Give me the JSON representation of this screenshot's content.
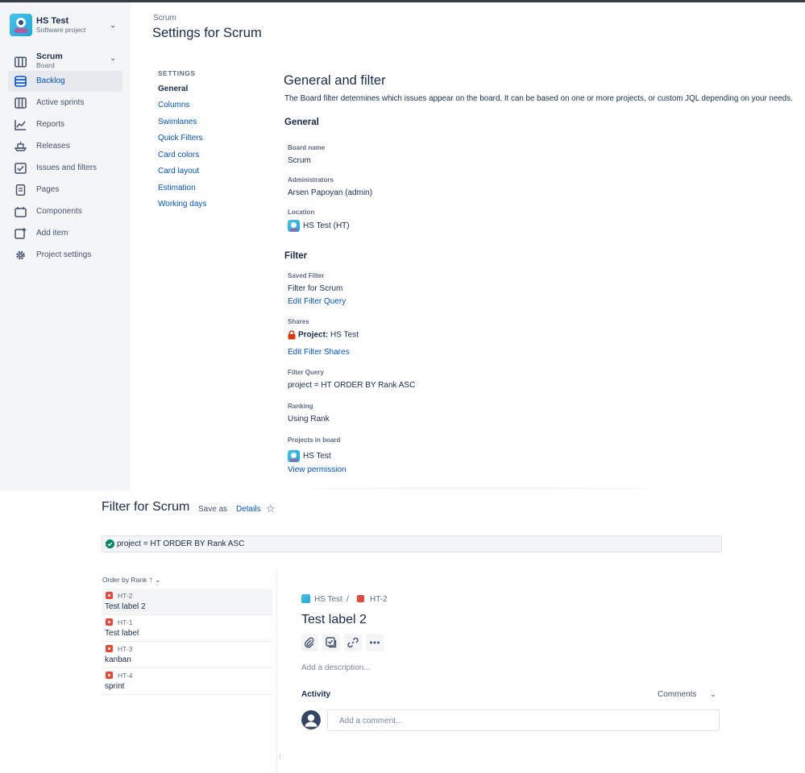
{
  "project": {
    "name": "HS Test",
    "type": "Software project"
  },
  "sidebar": {
    "board": {
      "name": "Scrum",
      "sub": "Board"
    },
    "items": [
      {
        "label": "Backlog",
        "icon": "backlog-icon"
      },
      {
        "label": "Active sprints",
        "icon": "board-columns-icon"
      },
      {
        "label": "Reports",
        "icon": "reports-chart-icon"
      },
      {
        "label": "Releases",
        "icon": "ship-icon"
      },
      {
        "label": "Issues and filters",
        "icon": "issues-icon"
      },
      {
        "label": "Pages",
        "icon": "page-icon"
      },
      {
        "label": "Components",
        "icon": "components-icon"
      },
      {
        "label": "Add item",
        "icon": "add-item-icon"
      },
      {
        "label": "Project settings",
        "icon": "gear-icon"
      }
    ]
  },
  "header": {
    "breadcrumb": "Scrum",
    "title": "Settings for Scrum"
  },
  "settings_nav": {
    "heading": "SETTINGS",
    "items": [
      "General",
      "Columns",
      "Swimlanes",
      "Quick Filters",
      "Card colors",
      "Card layout",
      "Estimation",
      "Working days"
    ]
  },
  "general": {
    "title": "General and filter",
    "description": "The Board filter determines which issues appear on the board. It can be based on one or more projects, or custom JQL depending on your needs.",
    "section_general": "General",
    "board_name_label": "Board name",
    "board_name": "Scrum",
    "administrators_label": "Administrators",
    "administrators": "Arsen Papoyan (admin)",
    "location_label": "Location",
    "location": "HS Test (HT)",
    "section_filter": "Filter",
    "saved_filter_label": "Saved Filter",
    "saved_filter": "Filter for Scrum",
    "edit_filter_query": "Edit Filter Query",
    "shares_label": "Shares",
    "shares_prefix": "Project:",
    "shares_value": "HS Test",
    "edit_filter_shares": "Edit Filter Shares",
    "filter_query_label": "Filter Query",
    "filter_query": "project = HT ORDER BY Rank ASC",
    "ranking_label": "Ranking",
    "ranking": "Using Rank",
    "projects_label": "Projects in board",
    "project_in_board": "HS Test",
    "view_permission": "View permission"
  },
  "filter_view": {
    "title": "Filter for Scrum",
    "save_as": "Save as",
    "details": "Details",
    "jql": "project = HT ORDER BY Rank ASC",
    "order_by": "Order by Rank",
    "issues": [
      {
        "key": "HT-2",
        "summary": "Test label 2"
      },
      {
        "key": "HT-1",
        "summary": "Test label"
      },
      {
        "key": "HT-3",
        "summary": "kanban"
      },
      {
        "key": "HT-4",
        "summary": "sprint"
      }
    ],
    "detail": {
      "project": "HS Test",
      "key": "HT-2",
      "title": "Test label 2",
      "description_placeholder": "Add a description...",
      "activity": "Activity",
      "comments_filter": "Comments",
      "comment_placeholder": "Add a comment..."
    }
  },
  "colors": {
    "accent": "#0052cc",
    "sidebar_bg": "#f4f5f7",
    "bug": "#e5493a",
    "success": "#00875a"
  }
}
